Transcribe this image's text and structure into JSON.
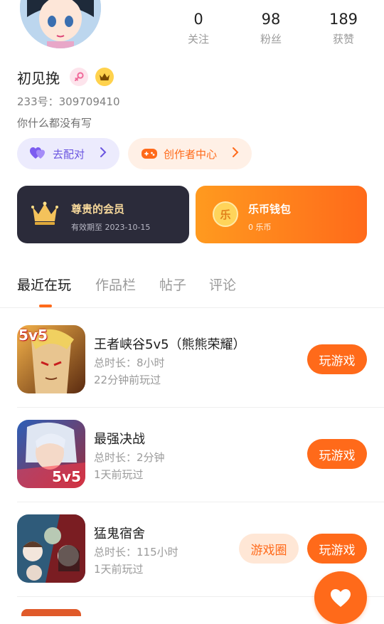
{
  "profile": {
    "nickname": "初见挽",
    "uid": "233号：309709410",
    "bio": "你什么都没有写"
  },
  "stats": [
    {
      "value": "0",
      "label": "关注"
    },
    {
      "value": "98",
      "label": "粉丝"
    },
    {
      "value": "189",
      "label": "获赞"
    }
  ],
  "actions": {
    "match_label": "去配对",
    "creator_label": "创作者中心"
  },
  "cards": {
    "vip_title": "尊贵的会员",
    "vip_expiry": "有效期至 2023-10-15",
    "wallet_title": "乐币钱包",
    "wallet_balance": "0 乐币",
    "wallet_coin": "乐"
  },
  "tabs": [
    "最近在玩",
    "作品栏",
    "帖子",
    "评论"
  ],
  "games": [
    {
      "title": "王者峡谷5v5（熊熊荣耀）",
      "duration": "总时长：8小时",
      "last_played": "22分钟前玩过",
      "play_label": "玩游戏",
      "icon_text": "5v5"
    },
    {
      "title": "最强决战",
      "duration": "总时长：2分钟",
      "last_played": "1天前玩过",
      "play_label": "玩游戏",
      "icon_text": "5v5"
    },
    {
      "title": "猛鬼宿舍",
      "duration": "总时长：115小时",
      "last_played": "1天前玩过",
      "play_label": "玩游戏",
      "circle_label": "游戏圈"
    }
  ],
  "colors": {
    "accent": "#ff6a1a",
    "vip_card": "#2b2b3a",
    "match_pill": "#ecebfd",
    "creator_pill": "#fff0e6"
  }
}
